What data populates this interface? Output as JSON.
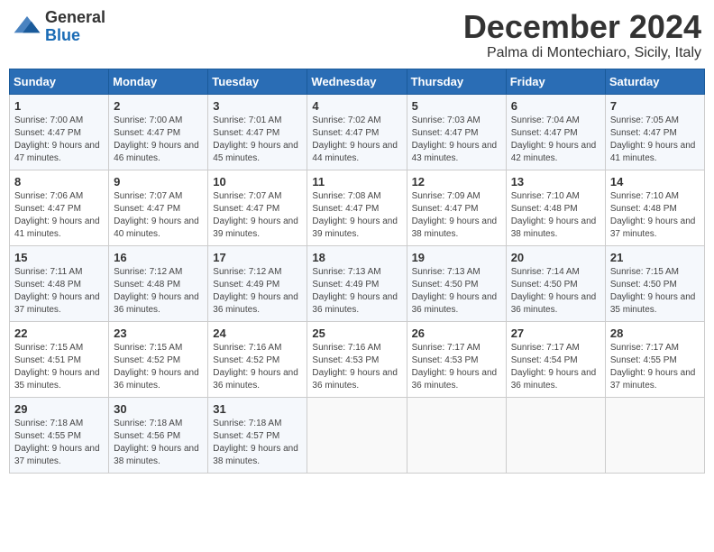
{
  "logo": {
    "general": "General",
    "blue": "Blue"
  },
  "header": {
    "month": "December 2024",
    "location": "Palma di Montechiaro, Sicily, Italy"
  },
  "weekdays": [
    "Sunday",
    "Monday",
    "Tuesday",
    "Wednesday",
    "Thursday",
    "Friday",
    "Saturday"
  ],
  "weeks": [
    [
      {
        "day": "1",
        "sunrise": "7:00 AM",
        "sunset": "4:47 PM",
        "daylight": "9 hours and 47 minutes."
      },
      {
        "day": "2",
        "sunrise": "7:00 AM",
        "sunset": "4:47 PM",
        "daylight": "9 hours and 46 minutes."
      },
      {
        "day": "3",
        "sunrise": "7:01 AM",
        "sunset": "4:47 PM",
        "daylight": "9 hours and 45 minutes."
      },
      {
        "day": "4",
        "sunrise": "7:02 AM",
        "sunset": "4:47 PM",
        "daylight": "9 hours and 44 minutes."
      },
      {
        "day": "5",
        "sunrise": "7:03 AM",
        "sunset": "4:47 PM",
        "daylight": "9 hours and 43 minutes."
      },
      {
        "day": "6",
        "sunrise": "7:04 AM",
        "sunset": "4:47 PM",
        "daylight": "9 hours and 42 minutes."
      },
      {
        "day": "7",
        "sunrise": "7:05 AM",
        "sunset": "4:47 PM",
        "daylight": "9 hours and 41 minutes."
      }
    ],
    [
      {
        "day": "8",
        "sunrise": "7:06 AM",
        "sunset": "4:47 PM",
        "daylight": "9 hours and 41 minutes."
      },
      {
        "day": "9",
        "sunrise": "7:07 AM",
        "sunset": "4:47 PM",
        "daylight": "9 hours and 40 minutes."
      },
      {
        "day": "10",
        "sunrise": "7:07 AM",
        "sunset": "4:47 PM",
        "daylight": "9 hours and 39 minutes."
      },
      {
        "day": "11",
        "sunrise": "7:08 AM",
        "sunset": "4:47 PM",
        "daylight": "9 hours and 39 minutes."
      },
      {
        "day": "12",
        "sunrise": "7:09 AM",
        "sunset": "4:47 PM",
        "daylight": "9 hours and 38 minutes."
      },
      {
        "day": "13",
        "sunrise": "7:10 AM",
        "sunset": "4:48 PM",
        "daylight": "9 hours and 38 minutes."
      },
      {
        "day": "14",
        "sunrise": "7:10 AM",
        "sunset": "4:48 PM",
        "daylight": "9 hours and 37 minutes."
      }
    ],
    [
      {
        "day": "15",
        "sunrise": "7:11 AM",
        "sunset": "4:48 PM",
        "daylight": "9 hours and 37 minutes."
      },
      {
        "day": "16",
        "sunrise": "7:12 AM",
        "sunset": "4:48 PM",
        "daylight": "9 hours and 36 minutes."
      },
      {
        "day": "17",
        "sunrise": "7:12 AM",
        "sunset": "4:49 PM",
        "daylight": "9 hours and 36 minutes."
      },
      {
        "day": "18",
        "sunrise": "7:13 AM",
        "sunset": "4:49 PM",
        "daylight": "9 hours and 36 minutes."
      },
      {
        "day": "19",
        "sunrise": "7:13 AM",
        "sunset": "4:50 PM",
        "daylight": "9 hours and 36 minutes."
      },
      {
        "day": "20",
        "sunrise": "7:14 AM",
        "sunset": "4:50 PM",
        "daylight": "9 hours and 36 minutes."
      },
      {
        "day": "21",
        "sunrise": "7:15 AM",
        "sunset": "4:50 PM",
        "daylight": "9 hours and 35 minutes."
      }
    ],
    [
      {
        "day": "22",
        "sunrise": "7:15 AM",
        "sunset": "4:51 PM",
        "daylight": "9 hours and 35 minutes."
      },
      {
        "day": "23",
        "sunrise": "7:15 AM",
        "sunset": "4:52 PM",
        "daylight": "9 hours and 36 minutes."
      },
      {
        "day": "24",
        "sunrise": "7:16 AM",
        "sunset": "4:52 PM",
        "daylight": "9 hours and 36 minutes."
      },
      {
        "day": "25",
        "sunrise": "7:16 AM",
        "sunset": "4:53 PM",
        "daylight": "9 hours and 36 minutes."
      },
      {
        "day": "26",
        "sunrise": "7:17 AM",
        "sunset": "4:53 PM",
        "daylight": "9 hours and 36 minutes."
      },
      {
        "day": "27",
        "sunrise": "7:17 AM",
        "sunset": "4:54 PM",
        "daylight": "9 hours and 36 minutes."
      },
      {
        "day": "28",
        "sunrise": "7:17 AM",
        "sunset": "4:55 PM",
        "daylight": "9 hours and 37 minutes."
      }
    ],
    [
      {
        "day": "29",
        "sunrise": "7:18 AM",
        "sunset": "4:55 PM",
        "daylight": "9 hours and 37 minutes."
      },
      {
        "day": "30",
        "sunrise": "7:18 AM",
        "sunset": "4:56 PM",
        "daylight": "9 hours and 38 minutes."
      },
      {
        "day": "31",
        "sunrise": "7:18 AM",
        "sunset": "4:57 PM",
        "daylight": "9 hours and 38 minutes."
      },
      null,
      null,
      null,
      null
    ]
  ],
  "labels": {
    "sunrise": "Sunrise:",
    "sunset": "Sunset:",
    "daylight": "Daylight:"
  }
}
